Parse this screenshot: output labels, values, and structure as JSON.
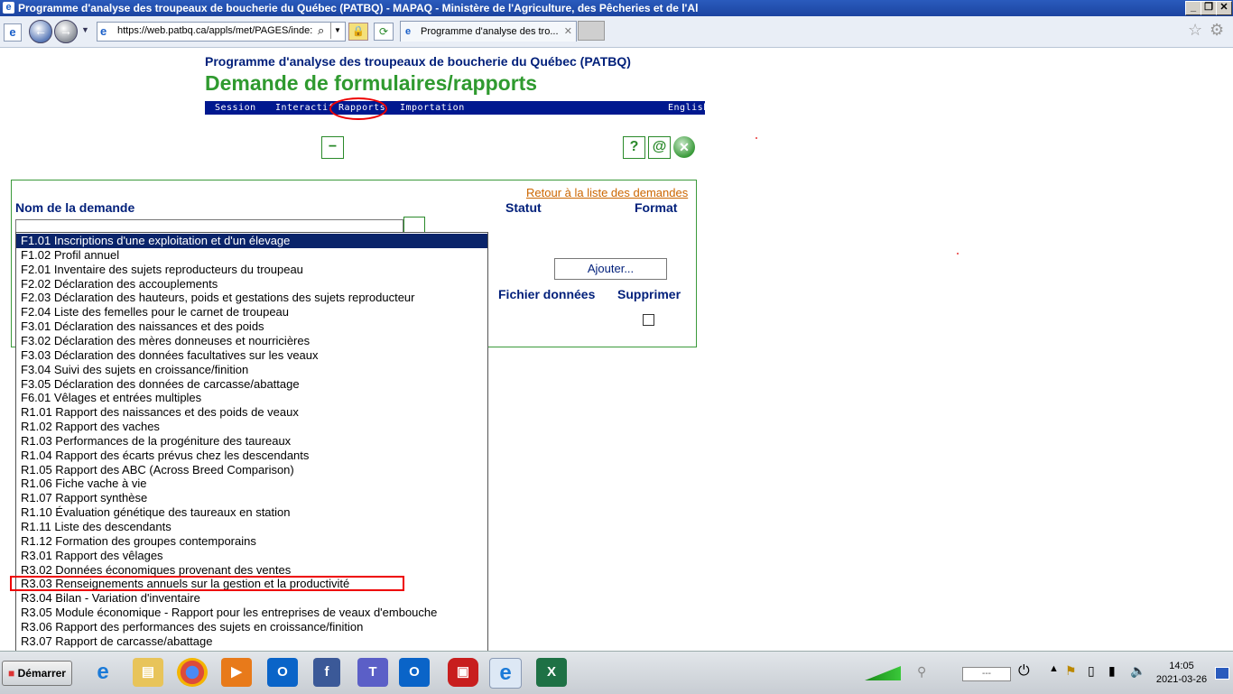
{
  "window": {
    "title": "Programme d'analyse des troupeaux de boucherie du Québec (PATBQ) - MAPAQ - Ministère de l'Agriculture, des Pêcheries et de l'Al",
    "minimize": "_",
    "restore": "❐",
    "close": "✕"
  },
  "browser": {
    "url": "https://web.patbq.ca/appls/met/PAGES/inde:",
    "tab_title": "Programme d'analyse des tro...",
    "tab_close": "✕",
    "back": "←",
    "forward": "→"
  },
  "header": {
    "subtitle": "Programme d'analyse des troupeaux de boucherie du Québec (PATBQ)",
    "title": "Demande de formulaires/rapports"
  },
  "nav": {
    "session": "Session",
    "interactif": "Interactif",
    "rapports": "Rapports",
    "importation": "Importation",
    "english": "English"
  },
  "icons": {
    "minus": "−",
    "help": "?",
    "email": "@",
    "close": "✕"
  },
  "form": {
    "retour_link": "Retour à la liste des demandes",
    "nom_label": "Nom de la demande",
    "statut_label": "Statut",
    "format_label": "Format",
    "ajouter_button": "Ajouter...",
    "fichier_label": "Fichier données",
    "supprimer_label": "Supprimer"
  },
  "dropdown": {
    "selected_index": 0,
    "highlighted_index": 24,
    "items": [
      "F1.01 Inscriptions d'une exploitation et d'un élevage",
      "F1.02 Profil annuel",
      "F2.01 Inventaire des sujets reproducteurs du troupeau",
      "F2.02 Déclaration des accouplements",
      "F2.03 Déclaration des hauteurs, poids et gestations des sujets reproducteur",
      "F2.04 Liste des femelles pour le carnet de troupeau",
      "F3.01 Déclaration des naissances et des poids",
      "F3.02 Déclaration des mères donneuses et nourricières",
      "F3.03 Déclaration des données facultatives sur les veaux",
      "F3.04 Suivi des sujets en croissance/finition",
      "F3.05 Déclaration des données de carcasse/abattage",
      "F6.01 Vêlages et entrées multiples",
      "R1.01 Rapport des naissances et des poids de veaux",
      "R1.02 Rapport des vaches",
      "R1.03 Performances de la progéniture des taureaux",
      "R1.04 Rapport des écarts prévus chez les descendants",
      "R1.05 Rapport des ABC (Across Breed Comparison)",
      "R1.06 Fiche vache à vie",
      "R1.07 Rapport synthèse",
      "R1.10 Évaluation génétique des taureaux en station",
      "R1.11 Liste des descendants",
      "R1.12 Formation des groupes contemporains",
      "R3.01 Rapport des vêlages",
      "R3.02 Données économiques provenant des ventes",
      "R3.03 Renseignements annuels sur la gestion et la productivité",
      "R3.04 Bilan - Variation d'inventaire",
      "R3.05 Module économique - Rapport pour les entreprises de veaux d'embouche",
      "R3.06 Rapport des performances des sujets en croissance/finition",
      "R3.07 Rapport de carcasse/abattage"
    ]
  },
  "taskbar": {
    "start": "Démarrer",
    "tray_box": "---",
    "time": "14:05",
    "date": "2021-03-26"
  },
  "colors": {
    "title_green": "#2f9a2f",
    "nav_blue": "#00188f",
    "label_blue": "#001f7a",
    "link_orange": "#cc6600",
    "highlight_red": "#e00000",
    "selection_blue": "#0a246a"
  }
}
